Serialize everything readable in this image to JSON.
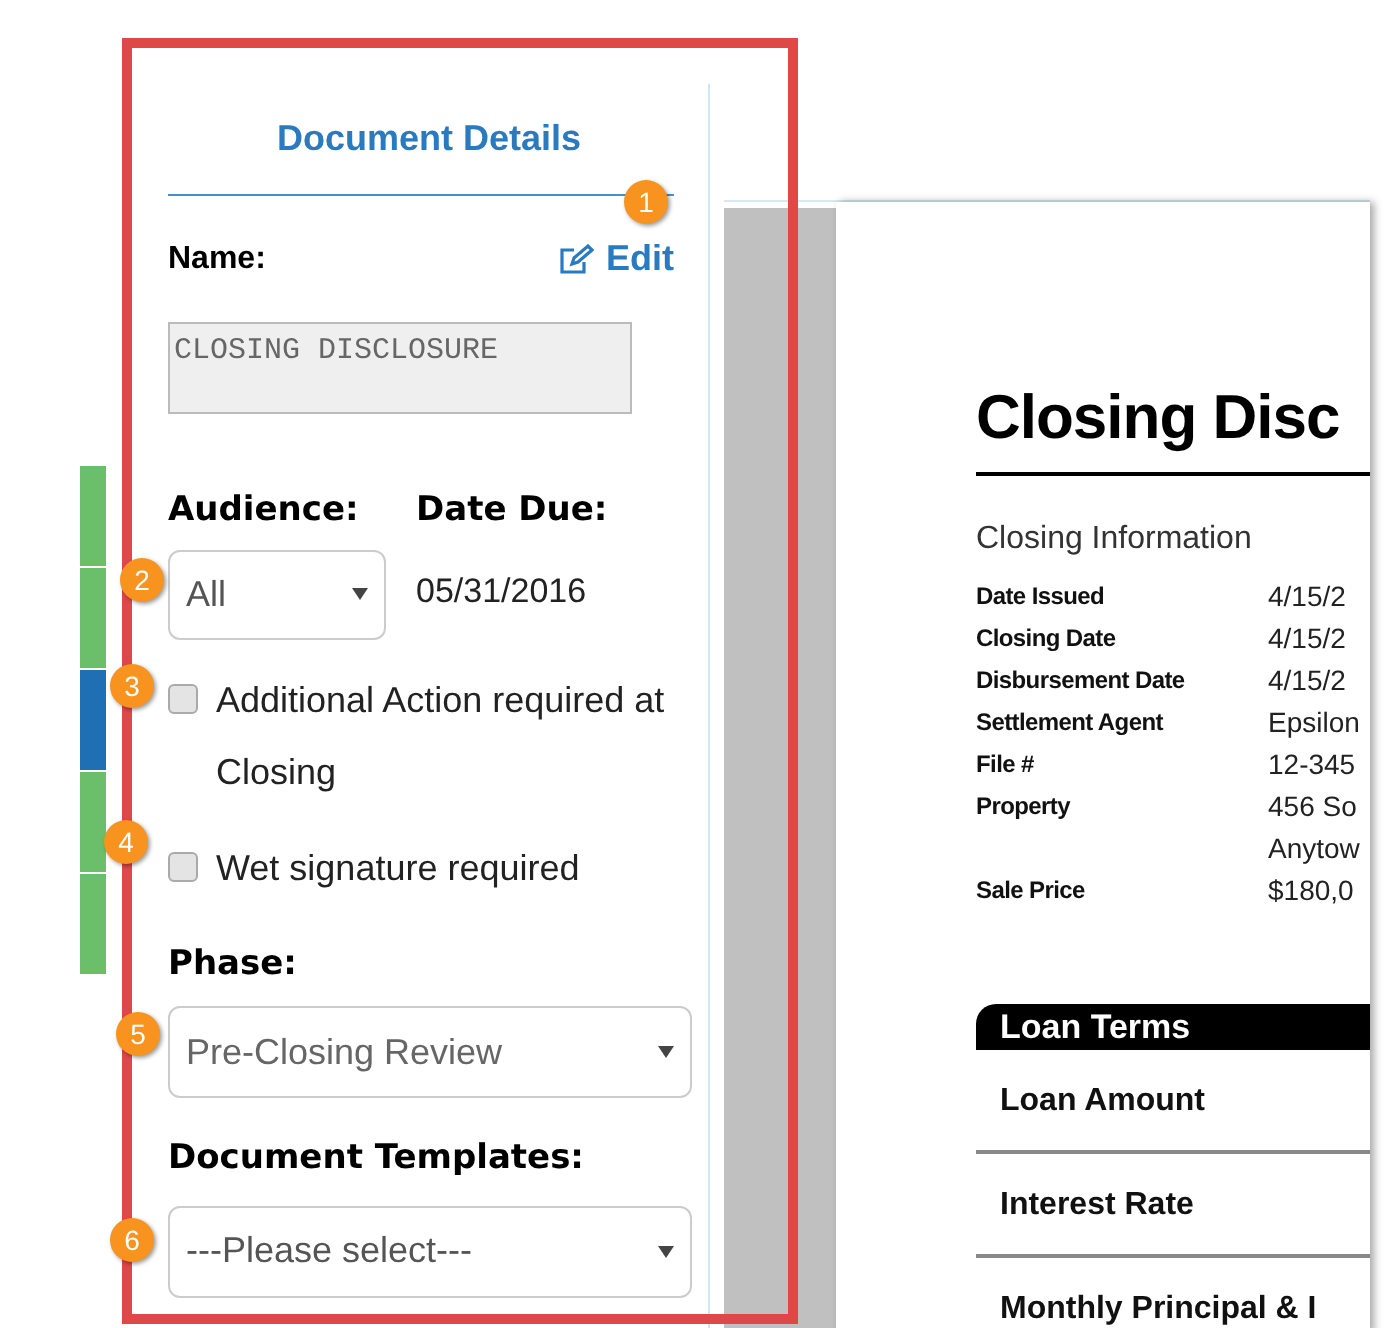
{
  "side_strip": [
    {
      "color": "#6cbf6a"
    },
    {
      "color": "#6cbf6a"
    },
    {
      "color": "#1f6fb5"
    },
    {
      "color": "#6cbf6a"
    },
    {
      "color": "#6cbf6a"
    }
  ],
  "panel": {
    "title": "Document Details",
    "name_label": "Name:",
    "edit_link": "Edit",
    "name_value": "CLOSING DISCLOSURE",
    "audience": {
      "label": "Audience:",
      "value": "All"
    },
    "date_due": {
      "label": "Date Due:",
      "value": "05/31/2016"
    },
    "checkboxes": [
      {
        "label": "Additional Action required at Closing",
        "checked": false
      },
      {
        "label": "Wet signature required",
        "checked": false
      }
    ],
    "phase": {
      "label": "Phase:",
      "value": "Pre-Closing Review"
    },
    "templates": {
      "label": "Document Templates:",
      "value": "---Please select---"
    }
  },
  "document": {
    "title": "Closing Disc",
    "section": "Closing Information",
    "rows": [
      {
        "label": "Date Issued",
        "values": [
          "4/15/2"
        ]
      },
      {
        "label": "Closing Date",
        "values": [
          "4/15/2"
        ]
      },
      {
        "label": "Disbursement Date",
        "values": [
          "4/15/2"
        ]
      },
      {
        "label": "Settlement Agent",
        "values": [
          "Epsilon"
        ]
      },
      {
        "label": "File #",
        "values": [
          "12-345"
        ]
      },
      {
        "label": "Property",
        "values": [
          "456 So",
          "Anytow"
        ]
      },
      {
        "label": "Sale Price",
        "values": [
          "$180,0"
        ]
      }
    ],
    "loan_terms": {
      "header": "Loan Terms",
      "rows": [
        "Loan Amount",
        "Interest Rate",
        "Monthly Principal & I"
      ]
    }
  },
  "annotations": [
    "1",
    "2",
    "3",
    "4",
    "5",
    "6"
  ]
}
